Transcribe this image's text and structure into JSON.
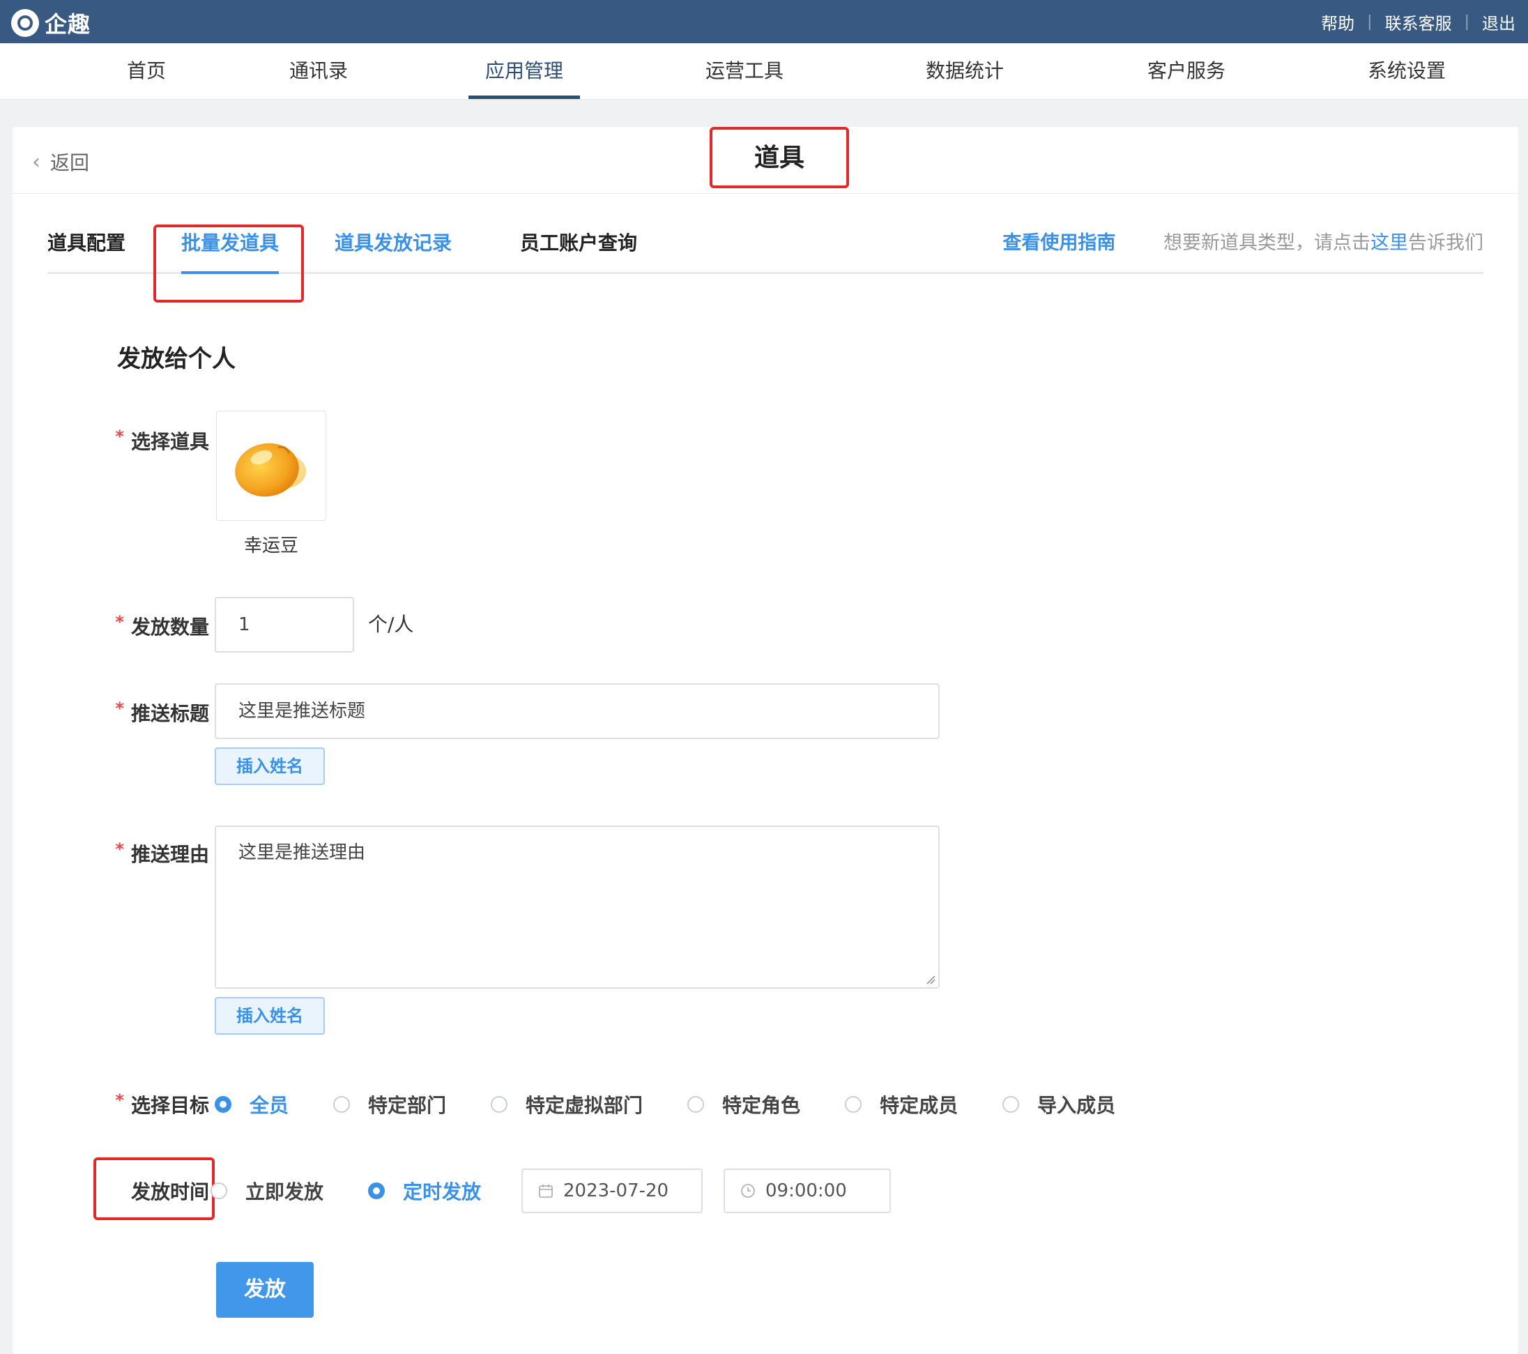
{
  "app": {
    "name": "企趣"
  },
  "top_links": [
    "帮助",
    "联系客服",
    "退出"
  ],
  "nav": {
    "items": [
      "首页",
      "通讯录",
      "应用管理",
      "运营工具",
      "数据统计",
      "客户服务",
      "系统设置"
    ],
    "active": "应用管理"
  },
  "header": {
    "back_label": "返回",
    "title": "道具"
  },
  "tabs": {
    "items": [
      "道具配置",
      "批量发道具",
      "道具发放记录",
      "员工账户查询"
    ],
    "active": "批量发道具",
    "guide_link": "查看使用指南",
    "hint_prefix": "想要新道具类型，请点击",
    "hint_link": "这里",
    "hint_suffix": "告诉我们"
  },
  "form": {
    "section_title": "发放给个人",
    "select_prop_label": "选择道具",
    "prop_name": "幸运豆",
    "quantity_label": "发放数量",
    "quantity_value": "1",
    "quantity_unit": "个/人",
    "push_title_label": "推送标题",
    "push_title_value": "这里是推送标题",
    "insert_name_label": "插入姓名",
    "push_reason_label": "推送理由",
    "push_reason_value": "这里是推送理由",
    "target_label": "选择目标",
    "target_options": [
      "全员",
      "特定部门",
      "特定虚拟部门",
      "特定角色",
      "特定成员",
      "导入成员"
    ],
    "target_selected": "全员",
    "time_label": "发放时间",
    "time_options": [
      "立即发放",
      "定时发放"
    ],
    "time_selected": "定时发放",
    "date_value": "2023-07-20",
    "time_value": "09:00:00",
    "submit_label": "发放"
  },
  "colors": {
    "topbar": "#385982",
    "accent": "#3a91e5",
    "highlight": "#e02a2a",
    "required": "#e44444"
  }
}
